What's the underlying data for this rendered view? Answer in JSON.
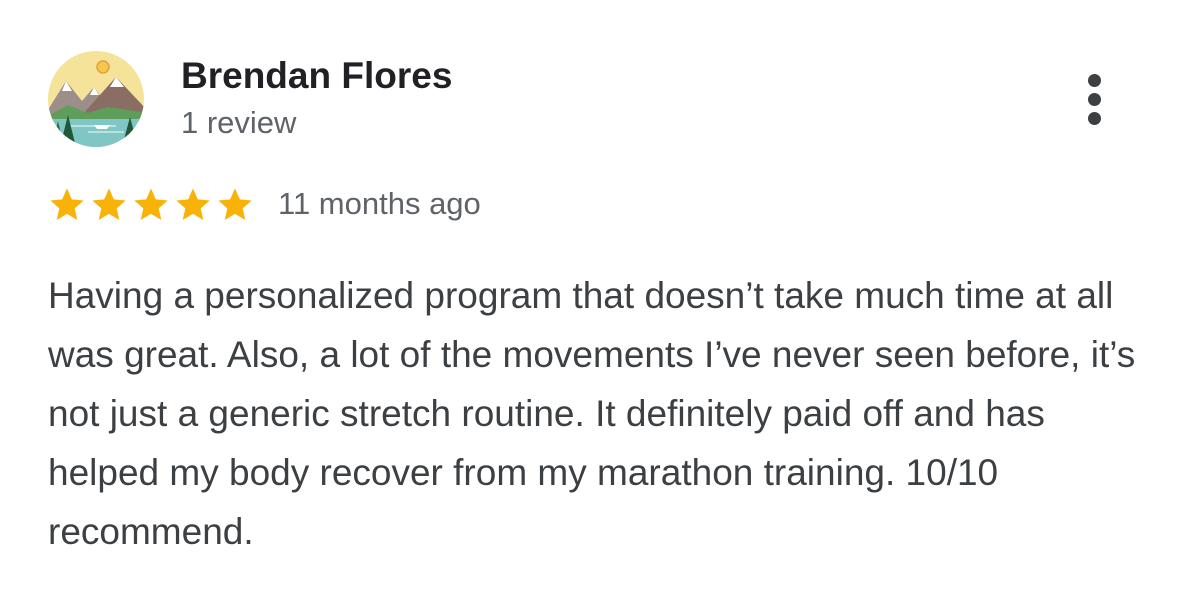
{
  "review": {
    "reviewer_name": "Brendan Flores",
    "review_count": "1 review",
    "rating": 5,
    "rating_max": 5,
    "star_color": "#F9B308",
    "date": "11 months ago",
    "text": "Having a personalized program that doesn’t take much time at all was great. Also, a lot of the movements I’ve never seen before, it’s not just a generic stretch routine. It definitely paid off and has helped my body recover from my marathon training. 10/10 recommend.",
    "avatar_icon": "mountain-lake-landscape-icon",
    "menu_icon": "more-vertical-icon"
  }
}
